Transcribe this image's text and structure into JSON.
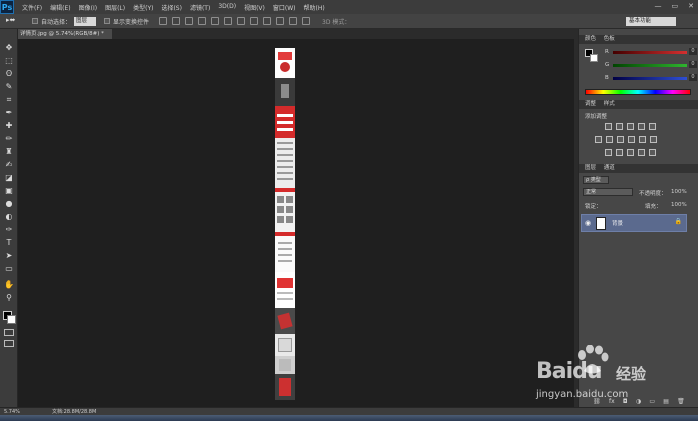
{
  "app": {
    "logo": "Ps"
  },
  "menu": [
    "文件(F)",
    "编辑(E)",
    "图像(I)",
    "图层(L)",
    "类型(Y)",
    "选择(S)",
    "滤镜(T)",
    "3D(D)",
    "视图(V)",
    "窗口(W)",
    "帮助(H)"
  ],
  "window_controls": {
    "minimize": "—",
    "maximize": "▭",
    "close": "✕"
  },
  "options_bar": {
    "tool_preset": "▸⬌",
    "auto_select_label": "自动选择：",
    "auto_select_value": "图层",
    "show_transform_label": "显示变换控件",
    "mode_3d_label": "3D 模式：",
    "workspace": "基本功能"
  },
  "document": {
    "tab_title": "详情页.jpg @ 5.74%(RGB/8#) *"
  },
  "tools": [
    "move-tool",
    "marquee-tool",
    "lasso-tool",
    "quick-select-tool",
    "crop-tool",
    "eyedropper-tool",
    "healing-tool",
    "brush-tool",
    "clone-stamp-tool",
    "history-brush-tool",
    "eraser-tool",
    "gradient-tool",
    "blur-tool",
    "dodge-tool",
    "pen-tool",
    "type-tool",
    "path-select-tool",
    "shape-tool",
    "hand-tool",
    "zoom-tool"
  ],
  "tool_glyphs": [
    "✥",
    "⬚",
    "ʘ",
    "✎",
    "⌗",
    "✒",
    "✚",
    "✏",
    "♜",
    "✍",
    "◪",
    "▣",
    "●",
    "◐",
    "✑",
    "T",
    "➤",
    "▭",
    "✋",
    "⚲"
  ],
  "panels": {
    "color_tabs": [
      "颜色",
      "色板"
    ],
    "color": {
      "rows": [
        {
          "label": "R",
          "value": "0",
          "color": "#d43030"
        },
        {
          "label": "G",
          "value": "0",
          "color": "#2fb52f"
        },
        {
          "label": "B",
          "value": "0",
          "color": "#2f4fd4"
        }
      ]
    },
    "adjust_tabs": [
      "调整",
      "样式"
    ],
    "adjust_title": "添加调整",
    "layers_tabs": [
      "图层",
      "通道"
    ],
    "kind_label": "ρ 类型",
    "blend_mode": "正常",
    "opacity_label": "不透明度：",
    "opacity_value": "100%",
    "lock_label": "锁定：",
    "fill_label": "填充：",
    "fill_value": "100%",
    "layer": {
      "name": "背景",
      "lock_icon": "🔒"
    },
    "bottom_icons": [
      "⛓",
      "fx",
      "◘",
      "◑",
      "▭",
      "▤",
      "🗑"
    ]
  },
  "status": {
    "zoom": "5.74%",
    "doc_size": "文档:28.8M/28.8M"
  },
  "watermark": {
    "logo": "Baidu",
    "cn": "经验",
    "url": "jingyan.baidu.com"
  }
}
